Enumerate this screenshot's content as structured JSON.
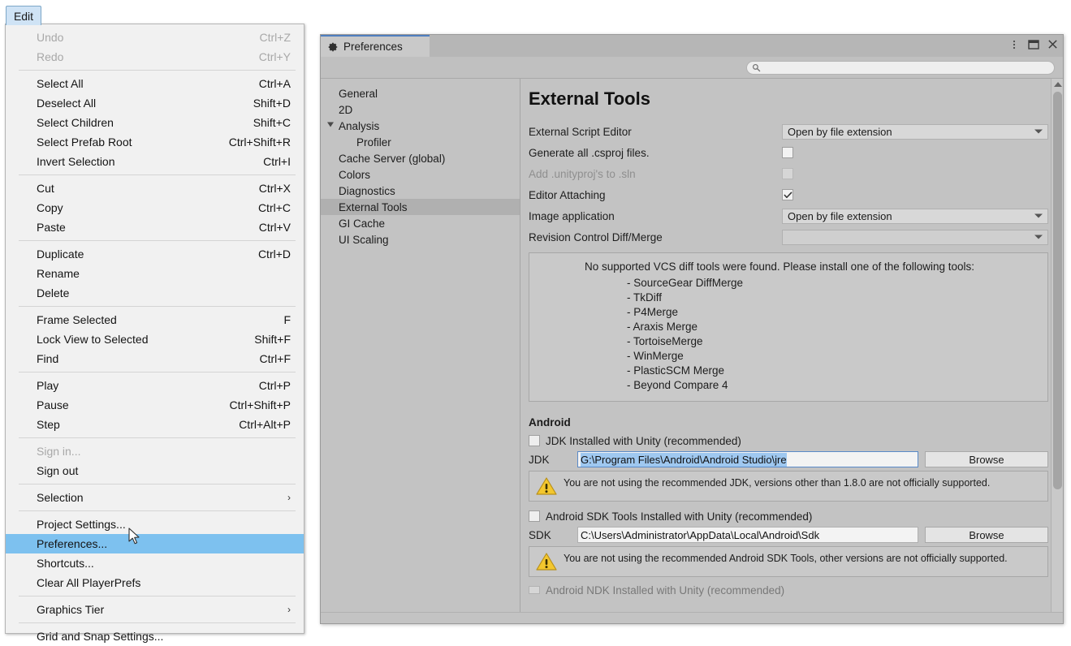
{
  "edit_menu": {
    "tab_label": "Edit",
    "items": [
      {
        "label": "Undo",
        "accel": "Ctrl+Z",
        "disabled": true
      },
      {
        "label": "Redo",
        "accel": "Ctrl+Y",
        "disabled": true
      },
      {
        "separator": true
      },
      {
        "label": "Select All",
        "accel": "Ctrl+A"
      },
      {
        "label": "Deselect All",
        "accel": "Shift+D"
      },
      {
        "label": "Select Children",
        "accel": "Shift+C"
      },
      {
        "label": "Select Prefab Root",
        "accel": "Ctrl+Shift+R"
      },
      {
        "label": "Invert Selection",
        "accel": "Ctrl+I"
      },
      {
        "separator": true
      },
      {
        "label": "Cut",
        "accel": "Ctrl+X"
      },
      {
        "label": "Copy",
        "accel": "Ctrl+C"
      },
      {
        "label": "Paste",
        "accel": "Ctrl+V"
      },
      {
        "separator": true
      },
      {
        "label": "Duplicate",
        "accel": "Ctrl+D"
      },
      {
        "label": "Rename",
        "accel": ""
      },
      {
        "label": "Delete",
        "accel": ""
      },
      {
        "separator": true
      },
      {
        "label": "Frame Selected",
        "accel": "F"
      },
      {
        "label": "Lock View to Selected",
        "accel": "Shift+F"
      },
      {
        "label": "Find",
        "accel": "Ctrl+F"
      },
      {
        "separator": true
      },
      {
        "label": "Play",
        "accel": "Ctrl+P"
      },
      {
        "label": "Pause",
        "accel": "Ctrl+Shift+P"
      },
      {
        "label": "Step",
        "accel": "Ctrl+Alt+P"
      },
      {
        "separator": true
      },
      {
        "label": "Sign in...",
        "accel": "",
        "disabled": true
      },
      {
        "label": "Sign out",
        "accel": ""
      },
      {
        "separator": true
      },
      {
        "label": "Selection",
        "accel": "",
        "submenu": true
      },
      {
        "separator": true
      },
      {
        "label": "Project Settings...",
        "accel": ""
      },
      {
        "label": "Preferences...",
        "accel": "",
        "selected": true
      },
      {
        "label": "Shortcuts...",
        "accel": ""
      },
      {
        "label": "Clear All PlayerPrefs",
        "accel": ""
      },
      {
        "separator": true
      },
      {
        "label": "Graphics Tier",
        "accel": "",
        "submenu": true
      },
      {
        "separator": true
      },
      {
        "label": "Grid and Snap Settings...",
        "accel": ""
      }
    ]
  },
  "prefs_window": {
    "tab_title": "Preferences",
    "tab_icon": "gear-icon",
    "controls": {
      "menu": "kebab-menu-icon",
      "maximize": "maximize-icon",
      "close": "close-icon"
    },
    "search": {
      "value": "",
      "placeholder": "",
      "icon": "search-icon"
    },
    "sidebar": {
      "items": [
        {
          "label": "General",
          "indent": false
        },
        {
          "label": "2D",
          "indent": false
        },
        {
          "label": "Analysis",
          "indent": false,
          "twisty": "open"
        },
        {
          "label": "Profiler",
          "indent": true
        },
        {
          "label": "Cache Server (global)",
          "indent": false
        },
        {
          "label": "Colors",
          "indent": false
        },
        {
          "label": "Diagnostics",
          "indent": false
        },
        {
          "label": "External Tools",
          "indent": false,
          "active": true
        },
        {
          "label": "GI Cache",
          "indent": false
        },
        {
          "label": "UI Scaling",
          "indent": false
        }
      ]
    },
    "content": {
      "title": "External Tools",
      "rows": [
        {
          "label": "External Script Editor",
          "type": "dropdown",
          "value": "Open by file extension"
        },
        {
          "label": "Generate all .csproj files.",
          "type": "checkbox",
          "checked": false,
          "dim": false
        },
        {
          "label": "Add .unityproj's to .sln",
          "type": "checkbox",
          "checked": false,
          "dim": true
        },
        {
          "label": "Editor Attaching",
          "type": "checkbox",
          "checked": true,
          "dim": false
        },
        {
          "label": "Image application",
          "type": "dropdown",
          "value": "Open by file extension"
        },
        {
          "label": "Revision Control Diff/Merge",
          "type": "dropdown",
          "value": ""
        }
      ],
      "vcs_notice": {
        "heading": "No supported VCS diff tools were found. Please install one of the following tools:",
        "tools": [
          "- SourceGear DiffMerge",
          "- TkDiff",
          "- P4Merge",
          "- Araxis Merge",
          "- TortoiseMerge",
          "- WinMerge",
          "- PlasticSCM Merge",
          "- Beyond Compare 4"
        ]
      },
      "android": {
        "heading": "Android",
        "jdk_unity_checkbox": {
          "label": "JDK Installed with Unity (recommended)",
          "checked": false
        },
        "jdk_path": {
          "label": "JDK",
          "value": "G:\\Program Files\\Android\\Android Studio\\jre",
          "selected": true,
          "browse_label": "Browse"
        },
        "jdk_warning": "You are not using the recommended JDK, versions other than 1.8.0 are not officially supported.",
        "sdk_unity_checkbox": {
          "label": "Android SDK Tools Installed with Unity (recommended)",
          "checked": false
        },
        "sdk_path": {
          "label": "SDK",
          "value": "C:\\Users\\Administrator\\AppData\\Local\\Android\\Sdk",
          "selected": false,
          "browse_label": "Browse"
        },
        "sdk_warning": "You are not using the recommended Android SDK Tools, other versions are not officially supported.",
        "partial_row_label": "Android NDK Installed with Unity (recommended)"
      }
    }
  },
  "colors": {
    "menu_highlight": "#7dc1ef",
    "tab_accent": "#4f7fbf",
    "warning": "#f0c22c",
    "selection": "#9fc8f0",
    "panel_bg": "#c3c3c3",
    "menu_bg": "#f1f1f1"
  }
}
